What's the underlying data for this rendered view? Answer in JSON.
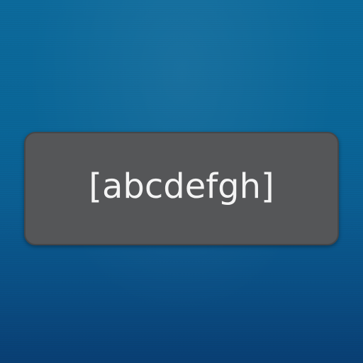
{
  "toast": {
    "message": "[abcdefgh]"
  }
}
